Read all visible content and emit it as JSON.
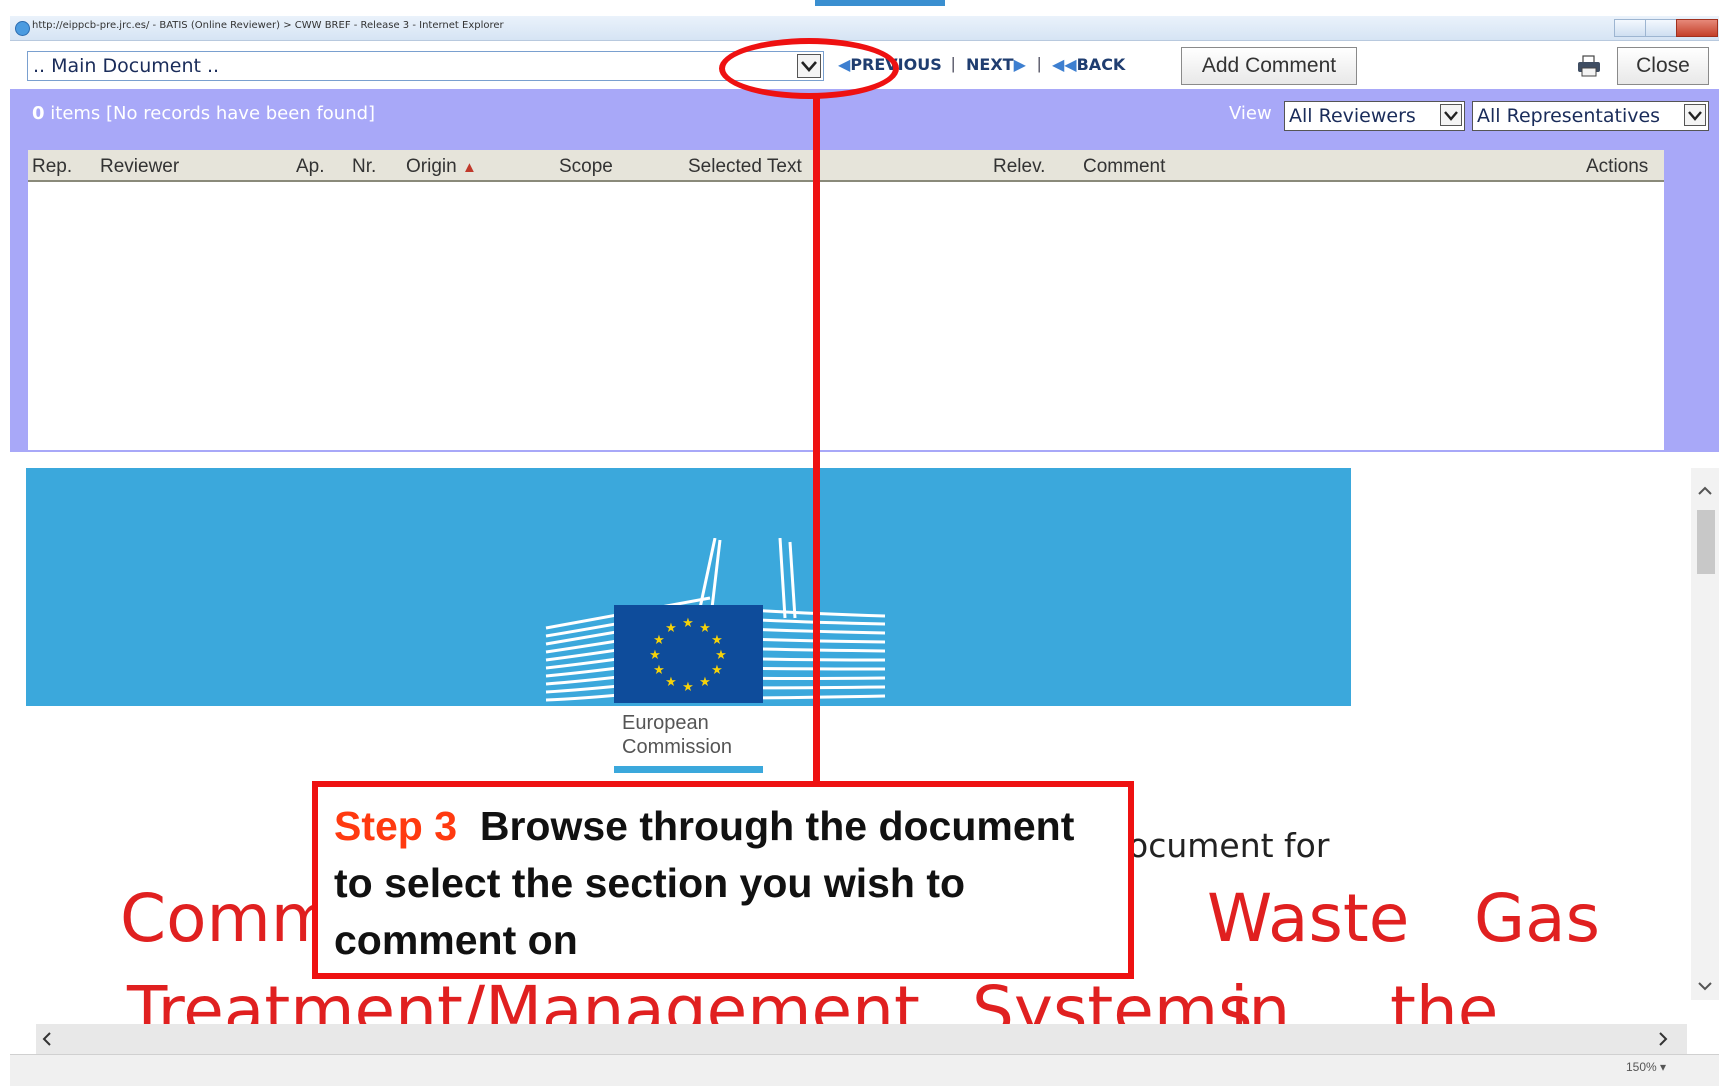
{
  "window": {
    "title": "http://eippcb-pre.jrc.es/ - BATIS (Online Reviewer) > CWW BREF - Release 3 - Internet Explorer",
    "zoom": "150%"
  },
  "toolbar": {
    "doc_select_value": ".. Main Document ..",
    "previous_label": "PREVIOUS",
    "next_label": "NEXT",
    "back_label": "BACK",
    "separator": "|",
    "add_comment_label": "Add Comment",
    "close_label": "Close"
  },
  "panel": {
    "items_count": "0",
    "items_text": "items [No records have been found]",
    "view_label": "View",
    "reviewers_value": "All Reviewers",
    "representatives_value": "All Representatives"
  },
  "table": {
    "columns": [
      "Rep.",
      "Reviewer",
      "Ap.",
      "Nr.",
      "Origin",
      "Scope",
      "Selected Text",
      "Relev.",
      "Comment",
      "Actions"
    ],
    "sort_indicator": "▲"
  },
  "document": {
    "logo_line1": "European",
    "logo_line2": "Commission",
    "subtitle_fragment": "ocument for",
    "title_line1_left": "Comm",
    "title_line1_mid": "Waste",
    "title_line1_right": "Gas",
    "title_line2_a": "Treatment/Management",
    "title_line2_b": "Systems",
    "title_line2_c": "in",
    "title_line2_d": "the"
  },
  "annotation": {
    "step_label": "Step 3",
    "step_text": "Browse through the document to select the section you wish to comment on",
    "accent_color": "#ee1111"
  },
  "colors": {
    "panel_bg": "#a8a8f8",
    "banner_bg": "#3ba8dc",
    "doc_red": "#e02020"
  }
}
